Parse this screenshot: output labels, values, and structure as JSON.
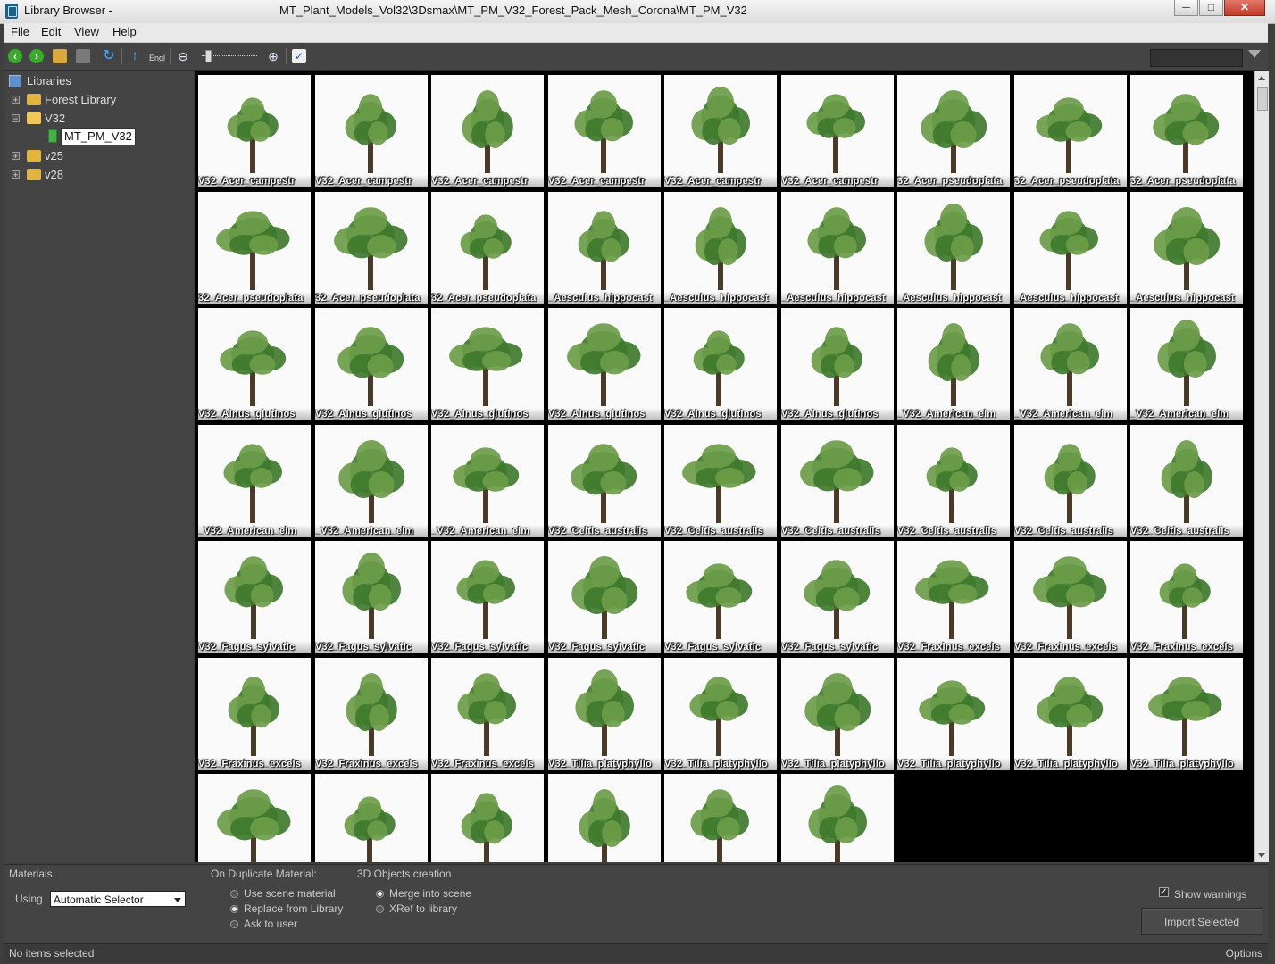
{
  "window": {
    "app_title": "Library Browser -",
    "path": "MT_Plant_Models_Vol32\\3Dsmax\\MT_PM_V32_Forest_Pack_Mesh_Corona\\MT_PM_V32",
    "minimize": "─",
    "maximize": "□",
    "close": "✕"
  },
  "menu": {
    "file": "File",
    "edit": "Edit",
    "view": "View",
    "help": "Help"
  },
  "toolbar": {
    "back_icon": "back-arrow-icon",
    "forward_icon": "forward-arrow-icon",
    "eng_label": "Engl"
  },
  "tree": {
    "root": "Libraries",
    "items": [
      {
        "label": "Forest Library"
      },
      {
        "label": "V32"
      },
      {
        "label": "MT_PM_V32"
      },
      {
        "label": "v25"
      },
      {
        "label": "v28"
      }
    ]
  },
  "thumbnails": [
    "V32_Acer_campestr",
    "V32_Acer_campestr",
    "V32_Acer_campestr",
    "V32_Acer_campestr",
    "V32_Acer_campestr",
    "V32_Acer_campestr",
    "32_Acer_pseudoplata",
    "32_Acer_pseudoplata",
    "32_Acer_pseudoplata",
    "32_Acer_pseudoplata",
    "32_Acer_pseudoplata",
    "32_Acer_pseudoplata",
    "_Aesculus_hippocast",
    "_Aesculus_hippocast",
    "_Aesculus_hippocast",
    "_Aesculus_hippocast",
    "_Aesculus_hippocast",
    "_Aesculus_hippocast",
    "V32_Alnus_glutinos",
    "V32_Alnus_glutinos",
    "V32_Alnus_glutinos",
    "V32_Alnus_glutinos",
    "V32_Alnus_glutinos",
    "V32_Alnus_glutinos",
    "_V32_American_elm",
    "_V32_American_elm",
    "_V32_American_elm",
    "_V32_American_elm",
    "_V32_American_elm",
    "_V32_American_elm",
    "V32_Celtis_australis",
    "V32_Celtis_australis",
    "V32_Celtis_australis",
    "V32_Celtis_australis",
    "V32_Celtis_australis",
    "V32_Celtis_australis",
    "V32_Fagus_sylvatic",
    "V32_Fagus_sylvatic",
    "V32_Fagus_sylvatic",
    "V32_Fagus_sylvatic",
    "V32_Fagus_sylvatic",
    "V32_Fagus_sylvatic",
    "V32_Fraxinus_excels",
    "V32_Fraxinus_excels",
    "V32_Fraxinus_excels",
    "V32_Fraxinus_excels",
    "V32_Fraxinus_excels",
    "V32_Fraxinus_excels",
    "V32_Tilia_platyphyllo",
    "V32_Tilia_platyphyllo",
    "V32_Tilia_platyphyllo",
    "V32_Tilia_platyphyllo",
    "V32_Tilia_platyphyllo",
    "V32_Tilia_platyphyllo",
    "",
    "",
    "",
    "",
    "",
    ""
  ],
  "bottom": {
    "materials_title": "Materials",
    "using_label": "Using",
    "using_value": "Automatic Selector",
    "duplicate_title": "On Duplicate Material:",
    "dup_options": [
      "Use scene material",
      "Replace from Library",
      "Ask to user"
    ],
    "objects_title": "3D Objects creation",
    "obj_options": [
      "Merge into scene",
      "XRef to library"
    ],
    "show_warnings": "Show warnings",
    "import_button": "Import Selected"
  },
  "status": {
    "text": "No items selected",
    "options": "Options"
  },
  "colors": {
    "foliage": "#3f7a2e",
    "foliage_light": "#6b9c48",
    "trunk": "#4a3a2a",
    "panel": "#444444"
  }
}
